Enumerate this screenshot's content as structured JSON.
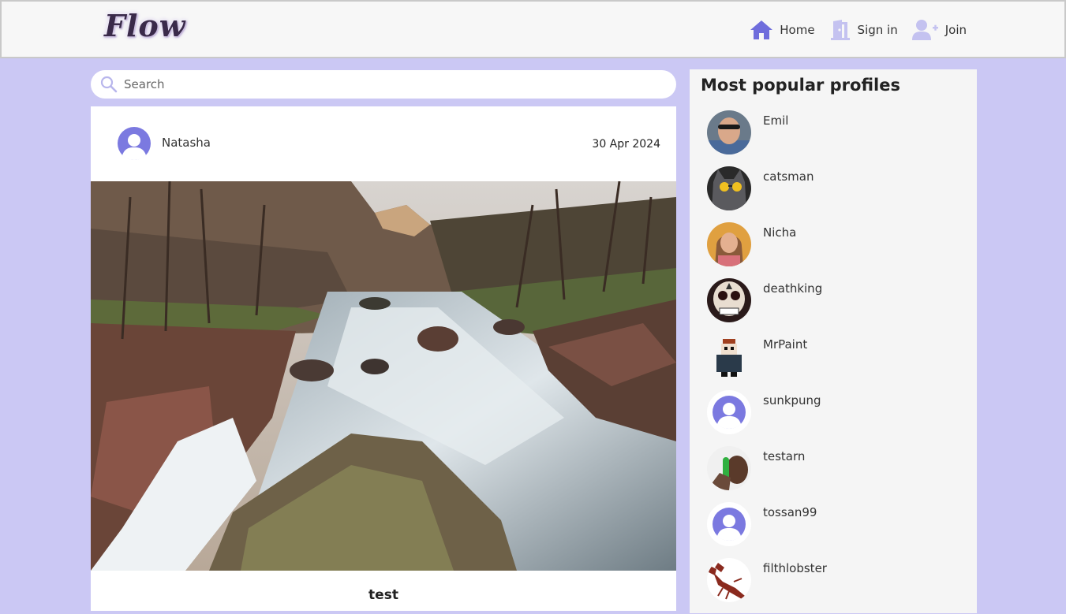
{
  "header": {
    "logo": "Flow",
    "nav": [
      {
        "label": "Home",
        "icon": "home-icon"
      },
      {
        "label": "Sign in",
        "icon": "door-icon"
      },
      {
        "label": "Join",
        "icon": "user-plus-icon"
      }
    ]
  },
  "search": {
    "placeholder": "Search",
    "value": ""
  },
  "post": {
    "author": "Natasha",
    "date": "30 Apr 2024",
    "title": "test",
    "image": "river-landscape-photo"
  },
  "sidebar": {
    "title": "Most popular profiles",
    "profiles": [
      {
        "name": "Emil",
        "avatar": "photo"
      },
      {
        "name": "catsman",
        "avatar": "cat-photo"
      },
      {
        "name": "Nicha",
        "avatar": "photo"
      },
      {
        "name": "deathking",
        "avatar": "skull-art"
      },
      {
        "name": "MrPaint",
        "avatar": "pixel-art"
      },
      {
        "name": "sunkpung",
        "avatar": "default"
      },
      {
        "name": "testarn",
        "avatar": "photo"
      },
      {
        "name": "tossan99",
        "avatar": "default"
      },
      {
        "name": "filthlobster",
        "avatar": "lobster-art"
      }
    ]
  },
  "colors": {
    "accent": "#7b79e0",
    "background": "#cbc8f4",
    "icon_muted": "#c4c2f0"
  }
}
